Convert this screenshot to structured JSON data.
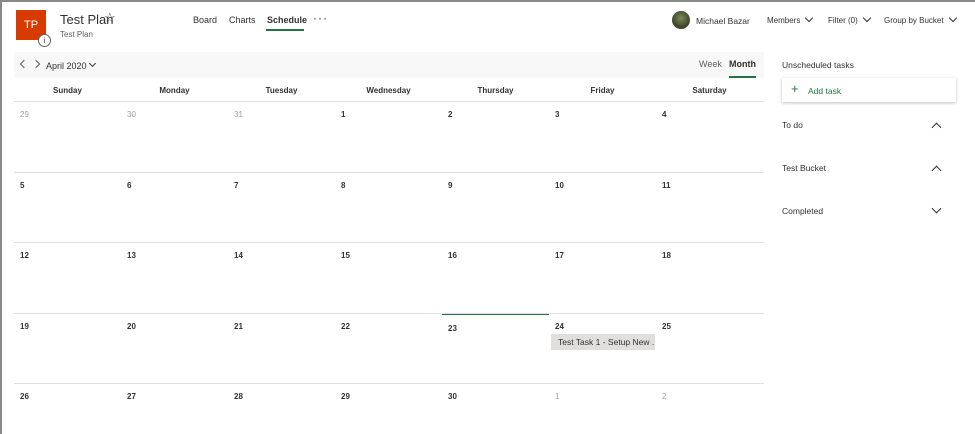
{
  "header": {
    "plan_initials": "TP",
    "info_glyph": "i",
    "plan_title": "Test Plan",
    "plan_subtitle": "Test Plan",
    "star_glyph": "☆",
    "tabs": [
      "Board",
      "Charts",
      "Schedule"
    ],
    "active_tab": "Schedule",
    "more_glyph": "···",
    "user_name": "Michael Bazar",
    "members_label": "Members",
    "filter_label": "Filter (0)",
    "group_label": "Group by Bucket"
  },
  "calendar": {
    "month_label": "April 2020",
    "views": [
      "Week",
      "Month"
    ],
    "active_view": "Month",
    "weekdays": [
      "Sunday",
      "Monday",
      "Tuesday",
      "Wednesday",
      "Thursday",
      "Friday",
      "Saturday"
    ],
    "weeks": [
      [
        "29",
        "30",
        "31",
        "1",
        "2",
        "3",
        "4"
      ],
      [
        "5",
        "6",
        "7",
        "8",
        "9",
        "10",
        "11"
      ],
      [
        "12",
        "13",
        "14",
        "15",
        "16",
        "17",
        "18"
      ],
      [
        "19",
        "20",
        "21",
        "22",
        "23",
        "24",
        "25"
      ],
      [
        "26",
        "27",
        "28",
        "29",
        "30",
        "1",
        "2"
      ]
    ],
    "today": "23",
    "tasks": [
      {
        "label": "Test Task 1 - Setup New ...",
        "date": "24"
      }
    ]
  },
  "panel": {
    "title": "Unscheduled tasks",
    "add_task_label": "Add task",
    "add_icon": "+",
    "buckets": [
      {
        "name": "To do",
        "state": "expanded"
      },
      {
        "name": "Test Bucket",
        "state": "expanded"
      },
      {
        "name": "Completed",
        "state": "collapsed"
      }
    ]
  },
  "colors": {
    "accent": "#217346",
    "plan_tile": "#d83b01",
    "grid_line": "#e1dfdd",
    "muted_text": "#a19f9d"
  }
}
